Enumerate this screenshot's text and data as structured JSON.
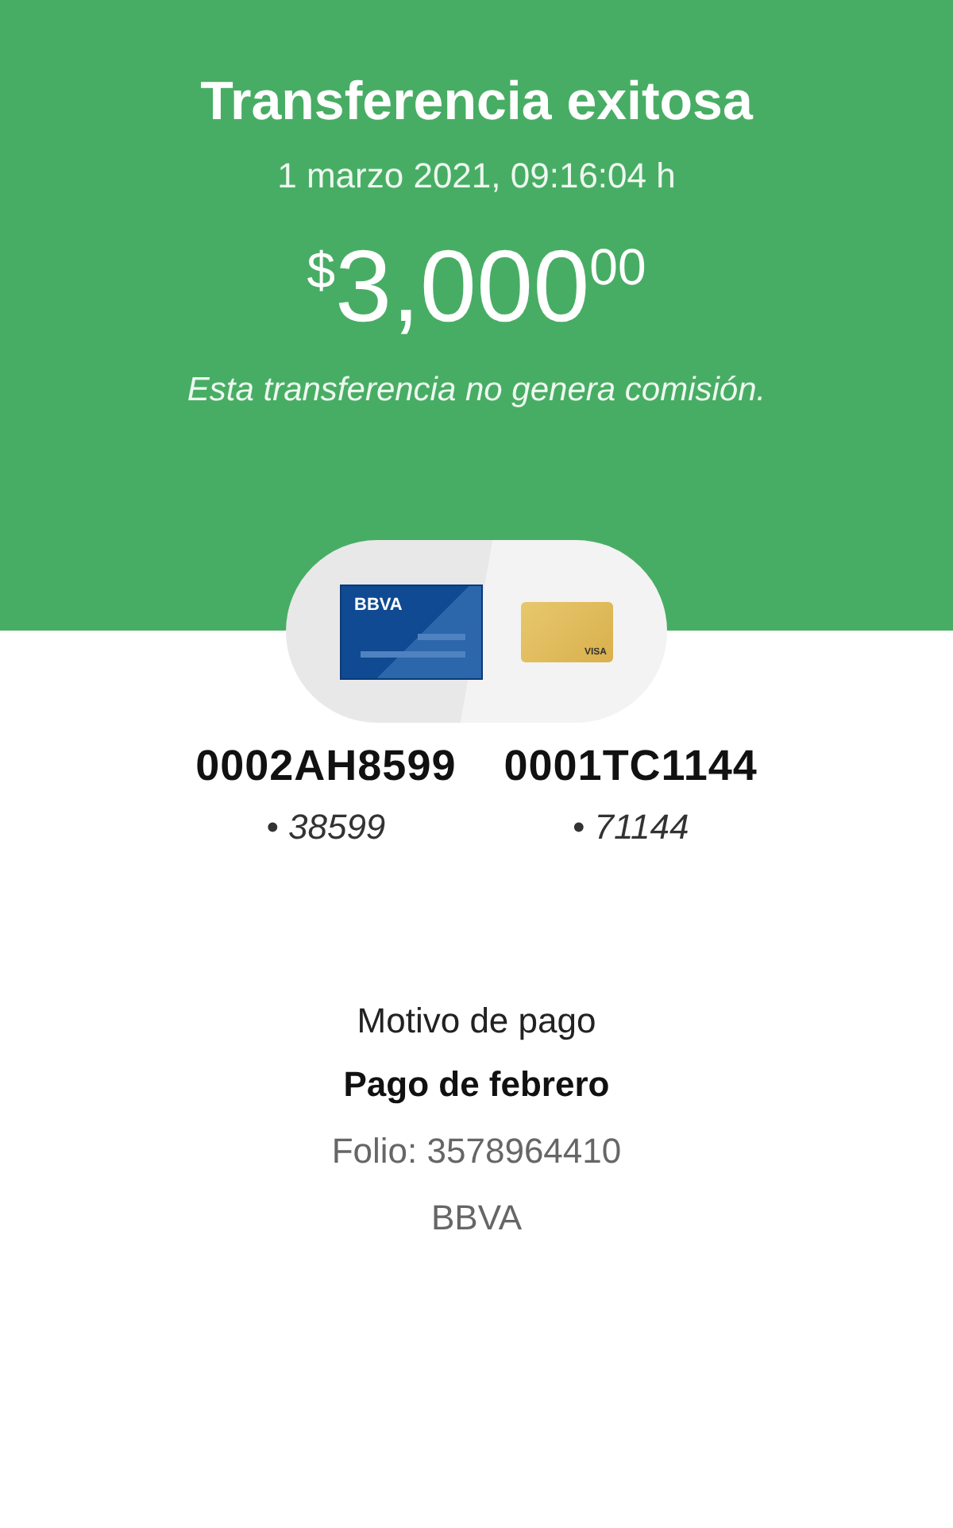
{
  "header": {
    "title": "Transferencia exitosa",
    "date": "1 marzo 2021, 09:16:04 h",
    "amount": {
      "currency": "$",
      "whole": "3,000",
      "cents": "00"
    },
    "note": "Esta transferencia no genera comisión."
  },
  "cards": [
    {
      "kind": "debit",
      "brand": "BBVA"
    },
    {
      "kind": "credit",
      "brand": "VISA"
    }
  ],
  "accounts": [
    {
      "number": "0002AH8599",
      "mask": "• 38599"
    },
    {
      "number": "0001TC1144",
      "mask": "• 71144"
    }
  ],
  "details": {
    "label": "Motivo de pago",
    "concept": "Pago de febrero",
    "folio": "Folio: 3578964410",
    "bank": "BBVA"
  }
}
